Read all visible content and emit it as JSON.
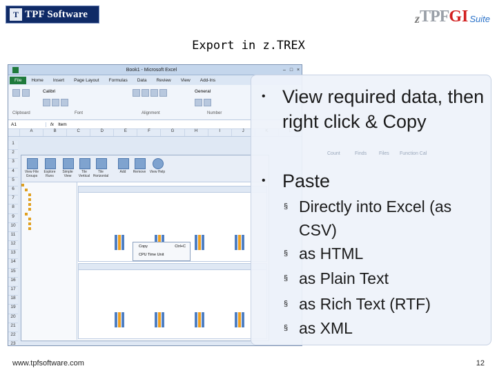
{
  "header": {
    "logo_left_text": "TPF Software",
    "logo_right_z": "z",
    "logo_right_tpf": "TPF",
    "logo_right_gi": "GI",
    "logo_right_suite": "Suite"
  },
  "slide": {
    "title": "Export in z.TREX",
    "bullets": [
      {
        "text": "View required data, then right click & Copy"
      },
      {
        "text": "Paste"
      }
    ],
    "sub_bullets": [
      "Directly into Excel (as CSV)",
      "as HTML",
      "as Plain Text",
      "as Rich Text (RTF)",
      "as XML"
    ],
    "bullet_glyph": "•",
    "sub_bullet_glyph": "§"
  },
  "screenshot": {
    "window_title": "Book1 - Microsoft Excel",
    "menu": [
      "File",
      "Home",
      "Insert",
      "Page Layout",
      "Formulas",
      "Data",
      "Review",
      "View",
      "Add-Ins"
    ],
    "ribbon_groups": [
      "Clipboard",
      "Font",
      "Alignment",
      "Number"
    ],
    "font_name": "Calibri",
    "number_format": "General",
    "namebox": "A1",
    "formula": "Item",
    "columns": [
      "A",
      "B",
      "C",
      "D",
      "E",
      "F",
      "G",
      "H",
      "I",
      "J",
      "K",
      "L"
    ],
    "rows": [
      "1",
      "2",
      "3",
      "4",
      "5",
      "6",
      "7",
      "8",
      "9",
      "10",
      "11",
      "12",
      "13",
      "14",
      "15",
      "16",
      "17",
      "18",
      "19",
      "20",
      "21",
      "22",
      "23"
    ],
    "inner_tools": [
      "View File Groups",
      "Explore Runs",
      "Simple View",
      "Tile Vertical",
      "Tile Horizontal",
      "Add",
      "Remove",
      "View Help"
    ],
    "context_menu": [
      "Copy",
      "CPU Time Unit"
    ],
    "context_shortcut": "Ctrl+C",
    "bg_columns": [
      "Count",
      "Finds",
      "Files",
      "Function Cal"
    ]
  },
  "footer": {
    "url": "www.tpfsoftware.com",
    "page": "12"
  }
}
